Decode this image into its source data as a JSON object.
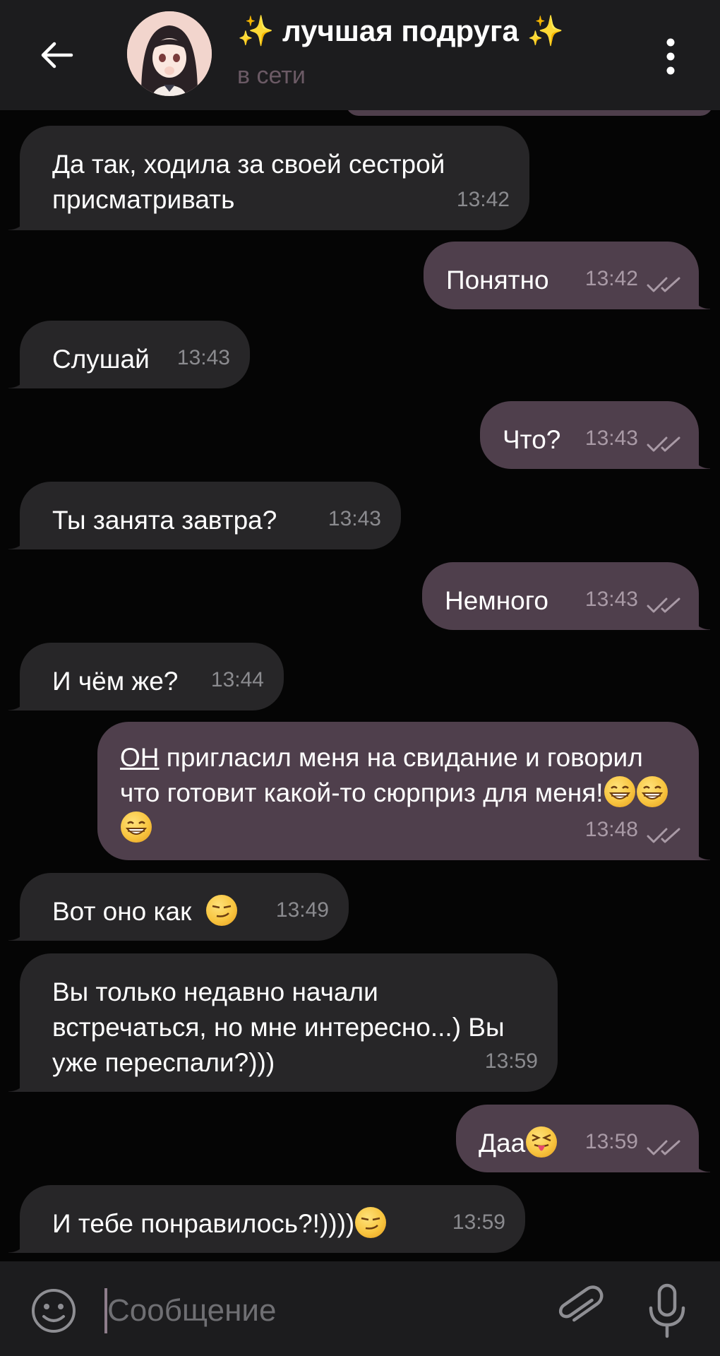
{
  "header": {
    "title": "✨ лучшая подруга ✨",
    "status": "в сети"
  },
  "messages": [
    {
      "dir": "in",
      "text": "Да так, ходила за своей сестрой присматривать",
      "time": "13:42"
    },
    {
      "dir": "out",
      "text": "Понятно",
      "time": "13:42",
      "read": true
    },
    {
      "dir": "in",
      "text": "Слушай",
      "time": "13:43"
    },
    {
      "dir": "out",
      "text": "Что?",
      "time": "13:43",
      "read": true
    },
    {
      "dir": "in",
      "text": "Ты занята завтра?",
      "time": "13:43"
    },
    {
      "dir": "out",
      "text": "Немного",
      "time": "13:43",
      "read": true
    },
    {
      "dir": "in",
      "text": "И чём же?",
      "time": "13:44"
    },
    {
      "dir": "out",
      "text_underlined": "ОН",
      "text": " пригласил меня на свидание и говорил что готовит какой-то сюрприз для меня!",
      "emoji": "grin-icon ×3",
      "time": "13:48",
      "read": true
    },
    {
      "dir": "in",
      "text": "Вот оно как",
      "emoji": "smirk-icon",
      "time": "13:49"
    },
    {
      "dir": "in",
      "text": "Вы только недавно начали встречаться, но мне интересно...) Вы уже переспали?)))",
      "time": "13:59"
    },
    {
      "dir": "out",
      "text": "Даа",
      "emoji": "tongue-squint-icon",
      "time": "13:59",
      "read": true
    },
    {
      "dir": "in",
      "text": "И тебе понравилось?!))))",
      "emoji": "smirk-icon",
      "time": "13:59"
    }
  ],
  "input": {
    "placeholder": "Сообщение"
  },
  "colors": {
    "header_bg": "#1c1c1e",
    "chat_bg": "#050505",
    "incoming_bubble": "#272628",
    "outgoing_bubble": "#4f3f4c",
    "time_text": "#8b8b8f"
  }
}
